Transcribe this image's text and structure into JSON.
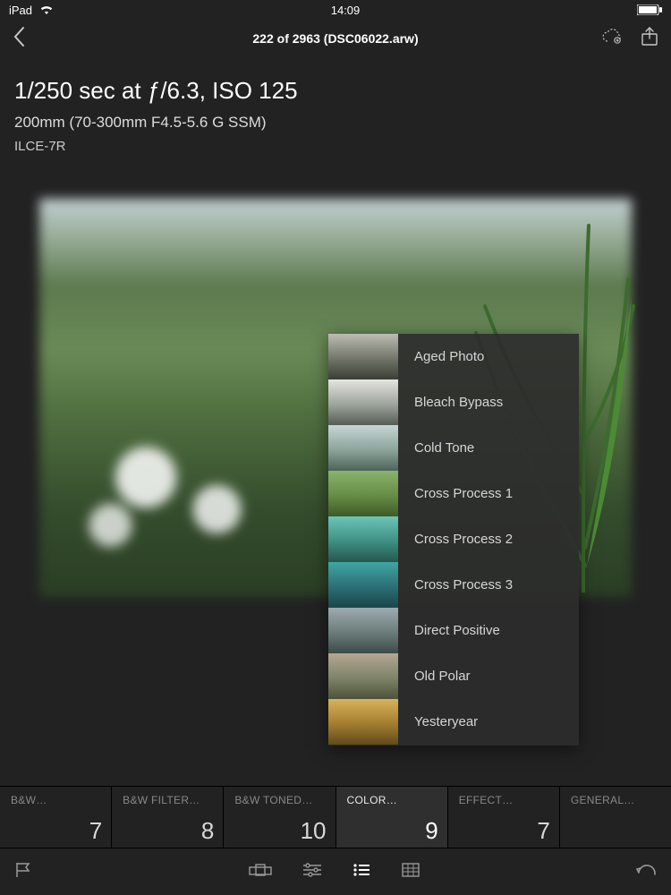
{
  "status": {
    "device": "iPad",
    "time": "14:09"
  },
  "nav": {
    "title": "222 of 2963 (DSC06022.arw)"
  },
  "exif": {
    "exposure": "1/250 sec at ƒ/6.3, ISO 125",
    "lens": "200mm (70-300mm F4.5-5.6 G SSM)",
    "camera": "ILCE-7R"
  },
  "presets": [
    {
      "name": "Aged Photo"
    },
    {
      "name": "Bleach Bypass"
    },
    {
      "name": "Cold Tone"
    },
    {
      "name": "Cross Process 1"
    },
    {
      "name": "Cross Process 2"
    },
    {
      "name": "Cross Process 3"
    },
    {
      "name": "Direct Positive"
    },
    {
      "name": "Old Polar"
    },
    {
      "name": "Yesteryear"
    }
  ],
  "categories": [
    {
      "label": "B&W…",
      "count": "7"
    },
    {
      "label": "B&W FILTER…",
      "count": "8"
    },
    {
      "label": "B&W TONED…",
      "count": "10"
    },
    {
      "label": "COLOR…",
      "count": "9",
      "active": true
    },
    {
      "label": "EFFECT…",
      "count": "7"
    },
    {
      "label": "GENERAL…",
      "count": ""
    }
  ]
}
